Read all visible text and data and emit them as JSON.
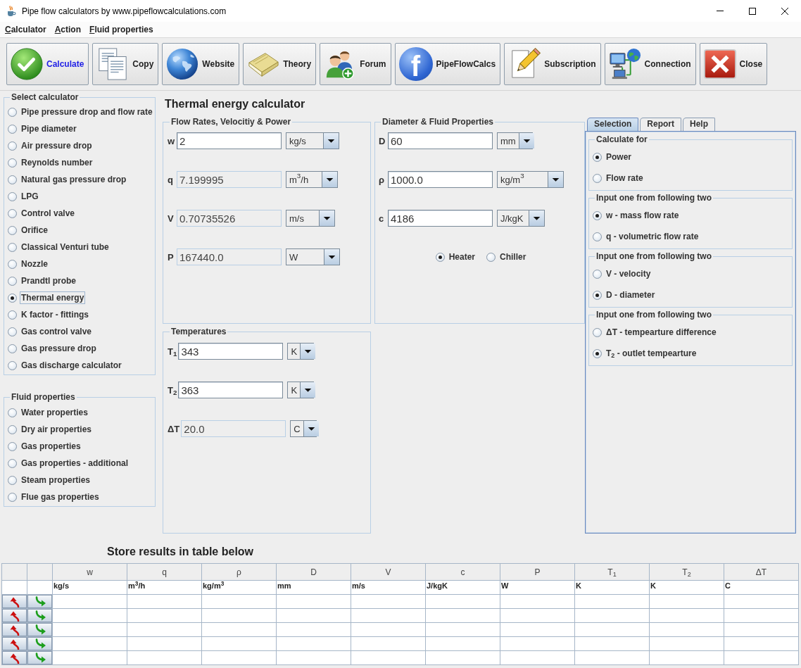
{
  "window": {
    "title": "Pipe flow calculators by www.pipeflowcalculations.com"
  },
  "menu": [
    {
      "label": "Calculator"
    },
    {
      "label": "Action"
    },
    {
      "label": "Fluid properties"
    }
  ],
  "toolbar": [
    {
      "label": "Calculate",
      "focused": true
    },
    {
      "label": "Copy",
      "focused": false
    },
    {
      "label": "Website",
      "focused": false
    },
    {
      "label": "Theory",
      "focused": false
    },
    {
      "label": "Forum",
      "focused": false
    },
    {
      "label": "PipeFlowCalcs",
      "focused": false,
      "logo_text": "f"
    },
    {
      "label": "Subscription",
      "focused": false
    },
    {
      "label": "Connection",
      "focused": false
    },
    {
      "label": "Close",
      "focused": false
    }
  ],
  "calculator_panel": {
    "title": "Select calculator",
    "items": [
      {
        "label": "Pipe pressure drop and flow rate",
        "selected": false
      },
      {
        "label": "Pipe diameter",
        "selected": false
      },
      {
        "label": "Air pressure drop",
        "selected": false
      },
      {
        "label": "Reynolds number",
        "selected": false
      },
      {
        "label": "Natural gas pressure drop",
        "selected": false
      },
      {
        "label": "LPG",
        "selected": false
      },
      {
        "label": "Control valve",
        "selected": false
      },
      {
        "label": "Orifice",
        "selected": false
      },
      {
        "label": "Classical Venturi tube",
        "selected": false
      },
      {
        "label": "Nozzle",
        "selected": false
      },
      {
        "label": "Prandtl probe",
        "selected": false
      },
      {
        "label": "Thermal energy",
        "selected": true
      },
      {
        "label": "K factor - fittings",
        "selected": false
      },
      {
        "label": "Gas control valve",
        "selected": false
      },
      {
        "label": "Gas pressure drop",
        "selected": false
      },
      {
        "label": "Gas discharge calculator",
        "selected": false
      }
    ]
  },
  "fluid_properties_panel": {
    "title": "Fluid properties",
    "items": [
      {
        "label": "Water properties",
        "selected": false
      },
      {
        "label": "Dry air properties",
        "selected": false
      },
      {
        "label": "Gas properties",
        "selected": false
      },
      {
        "label": "Gas properties - additional",
        "selected": false
      },
      {
        "label": "Steam properties",
        "selected": false
      },
      {
        "label": "Flue gas properties",
        "selected": false
      }
    ]
  },
  "calculator": {
    "title": "Thermal energy calculator"
  },
  "flow_group": {
    "title": "Flow Rates, Velocitiy & Power",
    "fields": [
      {
        "symbol": "w",
        "value": "2",
        "unit": "kg/s",
        "editable": true
      },
      {
        "symbol": "q",
        "value": "7.199995",
        "unit": "m$^{3}$/h",
        "editable": false
      },
      {
        "symbol": "V",
        "value": "0.70735526",
        "unit": "m/s",
        "editable": false
      },
      {
        "symbol": "P",
        "value": "167440.0",
        "unit": "W",
        "editable": false
      }
    ]
  },
  "fluid_group": {
    "title": "Diameter & Fluid Properties",
    "fields": [
      {
        "symbol": "D",
        "value": "60",
        "unit": "mm",
        "editable": true
      },
      {
        "symbol": "ρ",
        "value": "1000.0",
        "unit": "kg/m$^{3}$",
        "editable": true
      },
      {
        "symbol": "c",
        "value": "4186",
        "unit": "J/kgK",
        "editable": true
      }
    ],
    "modes": [
      {
        "label": "Heater",
        "selected": true
      },
      {
        "label": "Chiller",
        "selected": false
      }
    ]
  },
  "temperature_group": {
    "title": "Temperatures",
    "fields": [
      {
        "symbol": "T$_{1}$",
        "value": "343",
        "unit": "K",
        "editable": true
      },
      {
        "symbol": "T$_{2}$",
        "value": "363",
        "unit": "K",
        "editable": true
      },
      {
        "symbol": "ΔT",
        "value": "20.0",
        "unit": "C",
        "editable": false
      }
    ]
  },
  "tabs": [
    {
      "label": "Selection",
      "selected": true
    },
    {
      "label": "Report",
      "selected": false
    },
    {
      "label": "Help",
      "selected": false
    }
  ],
  "selection_groups": [
    {
      "title": "Calculate for",
      "options": [
        {
          "label": "Power",
          "selected": true
        },
        {
          "label": "Flow rate",
          "selected": false
        }
      ]
    },
    {
      "title": "Input one from following two",
      "options": [
        {
          "label": "w - mass flow rate",
          "selected": true
        },
        {
          "label": "q - volumetric flow rate",
          "selected": false
        }
      ]
    },
    {
      "title": "Input one from following two",
      "options": [
        {
          "label": "V - velocity",
          "selected": false
        },
        {
          "label": "D - diameter",
          "selected": true
        }
      ]
    },
    {
      "title": "Input one from following two",
      "options": [
        {
          "label": "ΔT - tempearture difference",
          "selected": false
        },
        {
          "label": "T$_{2}$ - outlet tempearture",
          "selected": true
        }
      ]
    }
  ],
  "results": {
    "title": "Store results in table below",
    "columns": [
      {
        "header": "w",
        "unit": "kg/s"
      },
      {
        "header": "q",
        "unit": "m$^{3}$/h"
      },
      {
        "header": "ρ",
        "unit": "kg/m$^{3}$"
      },
      {
        "header": "D",
        "unit": "mm"
      },
      {
        "header": "V",
        "unit": "m/s"
      },
      {
        "header": "c",
        "unit": "J/kgK"
      },
      {
        "header": "P",
        "unit": "W"
      },
      {
        "header": "T$_{1}$",
        "unit": "K"
      },
      {
        "header": "T$_{2}$",
        "unit": "K"
      },
      {
        "header": "ΔT",
        "unit": "C"
      }
    ],
    "rows": [
      {
        "kind": "empty"
      },
      {
        "kind": "empty"
      },
      {
        "kind": "empty"
      },
      {
        "kind": "empty"
      },
      {
        "kind": "empty"
      }
    ]
  }
}
